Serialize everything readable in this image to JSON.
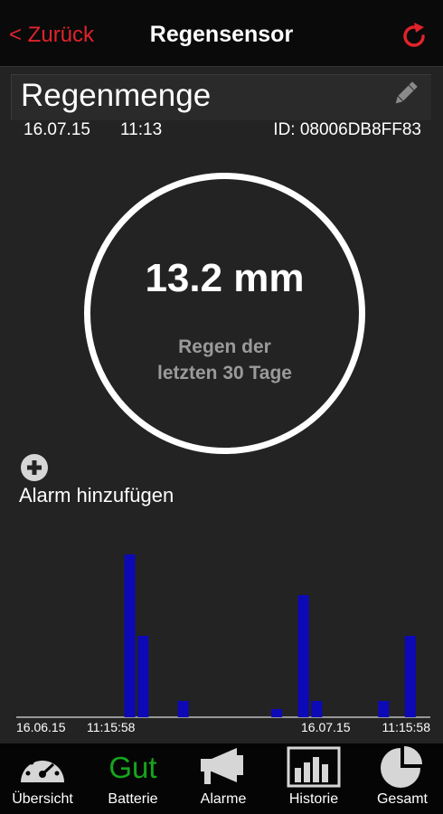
{
  "nav": {
    "back_label": "< Zurück",
    "title": "Regensensor"
  },
  "sensor": {
    "name": "Regenmenge",
    "date": "16.07.15",
    "time": "11:13",
    "id_label": "ID: 08006DB8FF83"
  },
  "gauge": {
    "value": "13.2 mm",
    "caption_line1": "Regen der",
    "caption_line2": "letzten 30 Tage"
  },
  "alarm": {
    "add_label": "Alarm hinzufügen"
  },
  "chart_data": {
    "type": "bar",
    "x_tick_labels": [
      "16.06.15",
      "11:15:58",
      "16.07.15",
      "11:15:58"
    ],
    "days": 31,
    "values": [
      0,
      0,
      0,
      0,
      0,
      0,
      0,
      0,
      1.0,
      0.5,
      0,
      0,
      0.1,
      0,
      0,
      0,
      0,
      0,
      0,
      0.05,
      0,
      0.75,
      0.1,
      0,
      0,
      0,
      0,
      0.1,
      0,
      0.5,
      0
    ],
    "ylim": [
      0,
      1.0
    ],
    "bar_color": "#0d09b6"
  },
  "tabs": [
    {
      "label": "Übersicht",
      "icon": "gauge-icon"
    },
    {
      "label": "Batterie",
      "status": "Gut",
      "status_color": "#15a51c"
    },
    {
      "label": "Alarme",
      "icon": "megaphone-icon"
    },
    {
      "label": "Historie",
      "icon": "bar-chart-icon"
    },
    {
      "label": "Gesamt",
      "icon": "pie-chart-icon"
    }
  ],
  "colors": {
    "accent": "#e0232b",
    "background": "#232323",
    "navbar": "#0a0a0a"
  }
}
